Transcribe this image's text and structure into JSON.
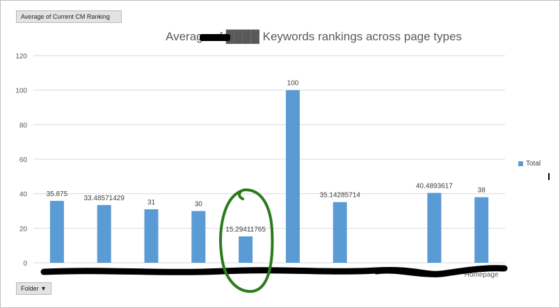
{
  "field_button": {
    "label": "Average of Current CM Ranking"
  },
  "axis_button": {
    "label": "Folder"
  },
  "legend": {
    "label": "Total",
    "color": "#5b9bd5"
  },
  "colors": {
    "bar": "#5b9bd5",
    "redaction": "#000000",
    "annotation": "#2d7a1e"
  },
  "chart_data": {
    "type": "bar",
    "title": "Average of ████ Keywords rankings across page types",
    "ylim": [
      0,
      120
    ],
    "yticks": [
      0,
      20,
      40,
      60,
      80,
      100,
      120
    ],
    "grid": true,
    "legend_position": "right",
    "categories": [
      "",
      "",
      "",
      "",
      "",
      "",
      "",
      "",
      "",
      "Homepage"
    ],
    "series": [
      {
        "name": "Total",
        "values": [
          35.875,
          33.48571429,
          31,
          30,
          15.29411765,
          100,
          35.14285714,
          null,
          40.4893617,
          38
        ],
        "labels": [
          "35.875",
          "33.48571429",
          "31",
          "30",
          "15.29411765",
          "100",
          "35.14285714",
          "",
          "40.4893617",
          "38"
        ]
      }
    ]
  }
}
